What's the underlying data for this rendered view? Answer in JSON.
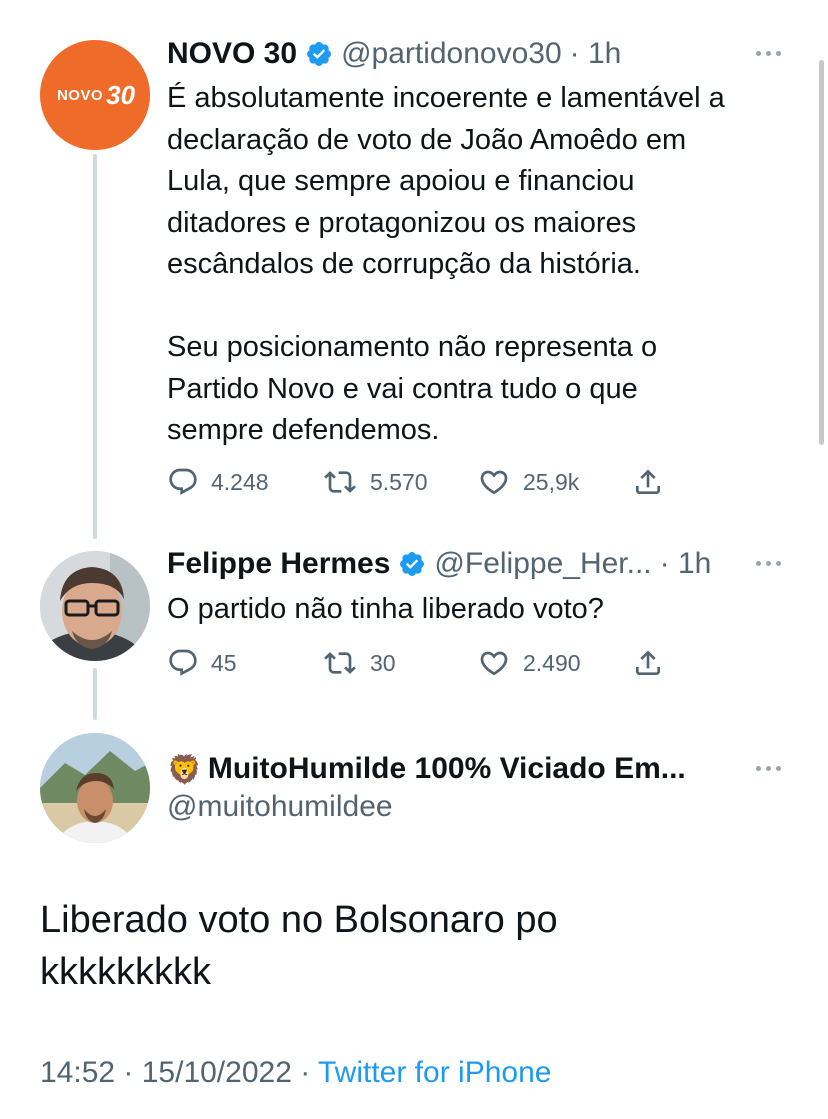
{
  "tweet1": {
    "avatar_text": "NOVO",
    "avatar_number": "30",
    "name": "NOVO 30",
    "handle": "@partidonovo30",
    "time": "· 1h",
    "text": "É absolutamente incoerente e lamentável a\ndeclaração de voto de João Amoêdo em\nLula, que sempre apoiou e financiou\nditadores e protagonizou os maiores\nescândalos de corrupção da história.\n\nSeu posicionamento não representa o\nPartido Novo e vai contra tudo o que\nsempre defendemos.",
    "replies": "4.248",
    "retweets": "5.570",
    "likes": "25,9k"
  },
  "tweet2": {
    "name": "Felippe Hermes",
    "handle": "@Felippe_Her...",
    "time": "· 1h",
    "text": "O partido não tinha liberado voto?",
    "replies": "45",
    "retweets": "30",
    "likes": "2.490"
  },
  "tweet3": {
    "emoji": "🦁",
    "name": "MuitoHumilde 100% Viciado Em...",
    "handle": "@muitohumildee",
    "text": "Liberado voto no Bolsonaro po\nkkkkkkkkk",
    "timestamp": "14:52 · 15/10/2022 · ",
    "source": "Twitter for iPhone"
  },
  "colors": {
    "verified_blue": "#1d9bf0",
    "link_blue": "#1d9bf0",
    "novo_orange": "#ee6b2a",
    "secondary_gray": "#536471"
  },
  "icons": [
    "verified-badge-icon",
    "reply-icon",
    "retweet-icon",
    "like-icon",
    "share-icon",
    "more-icon"
  ]
}
